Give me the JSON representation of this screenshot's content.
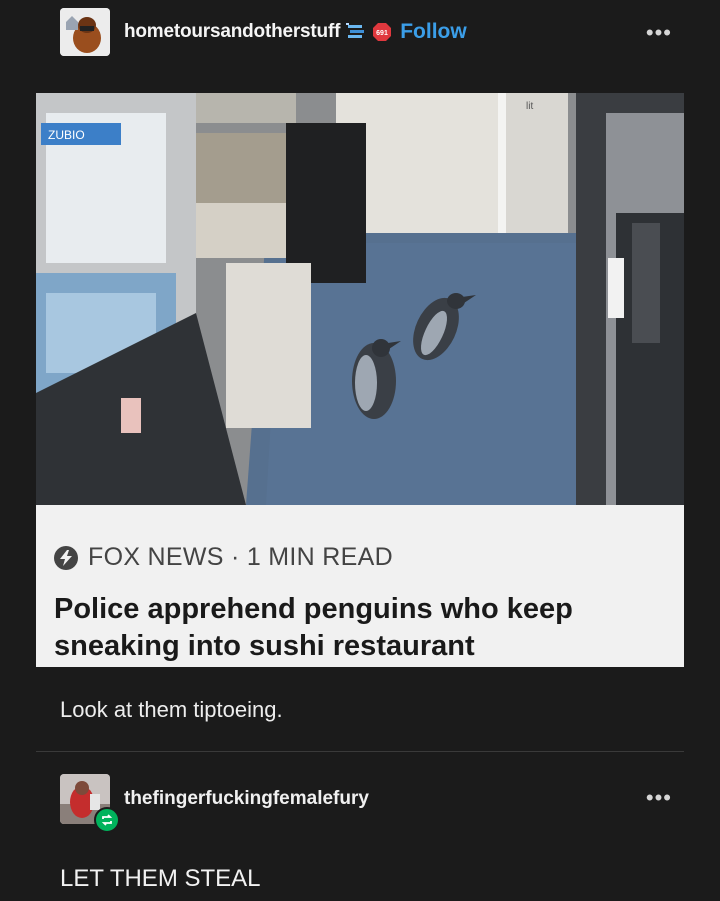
{
  "post": {
    "username": "hometoursandotherstuff",
    "follow_label": "Follow",
    "more_label": "•••",
    "news_card": {
      "source": "FOX NEWS · 1 MIN READ",
      "headline": "Police apprehend penguins who keep sneaking into sushi restaurant"
    },
    "photo_sign_text": "ZUBIO",
    "caption": "Look at them tiptoeing."
  },
  "reblog": {
    "username": "thefingerfuckingfemalefury",
    "more_label": "•••",
    "text": "LET THEM STEAL"
  },
  "colors": {
    "background": "#1b1b1b",
    "follow_blue": "#3b9ee8",
    "reblog_green": "#00b35c",
    "floor_blue": "#56708f"
  },
  "icons": [
    "avatar",
    "blue-badge-icon",
    "red-badge-icon",
    "more-icon",
    "bolt-icon",
    "reblog-icon"
  ]
}
